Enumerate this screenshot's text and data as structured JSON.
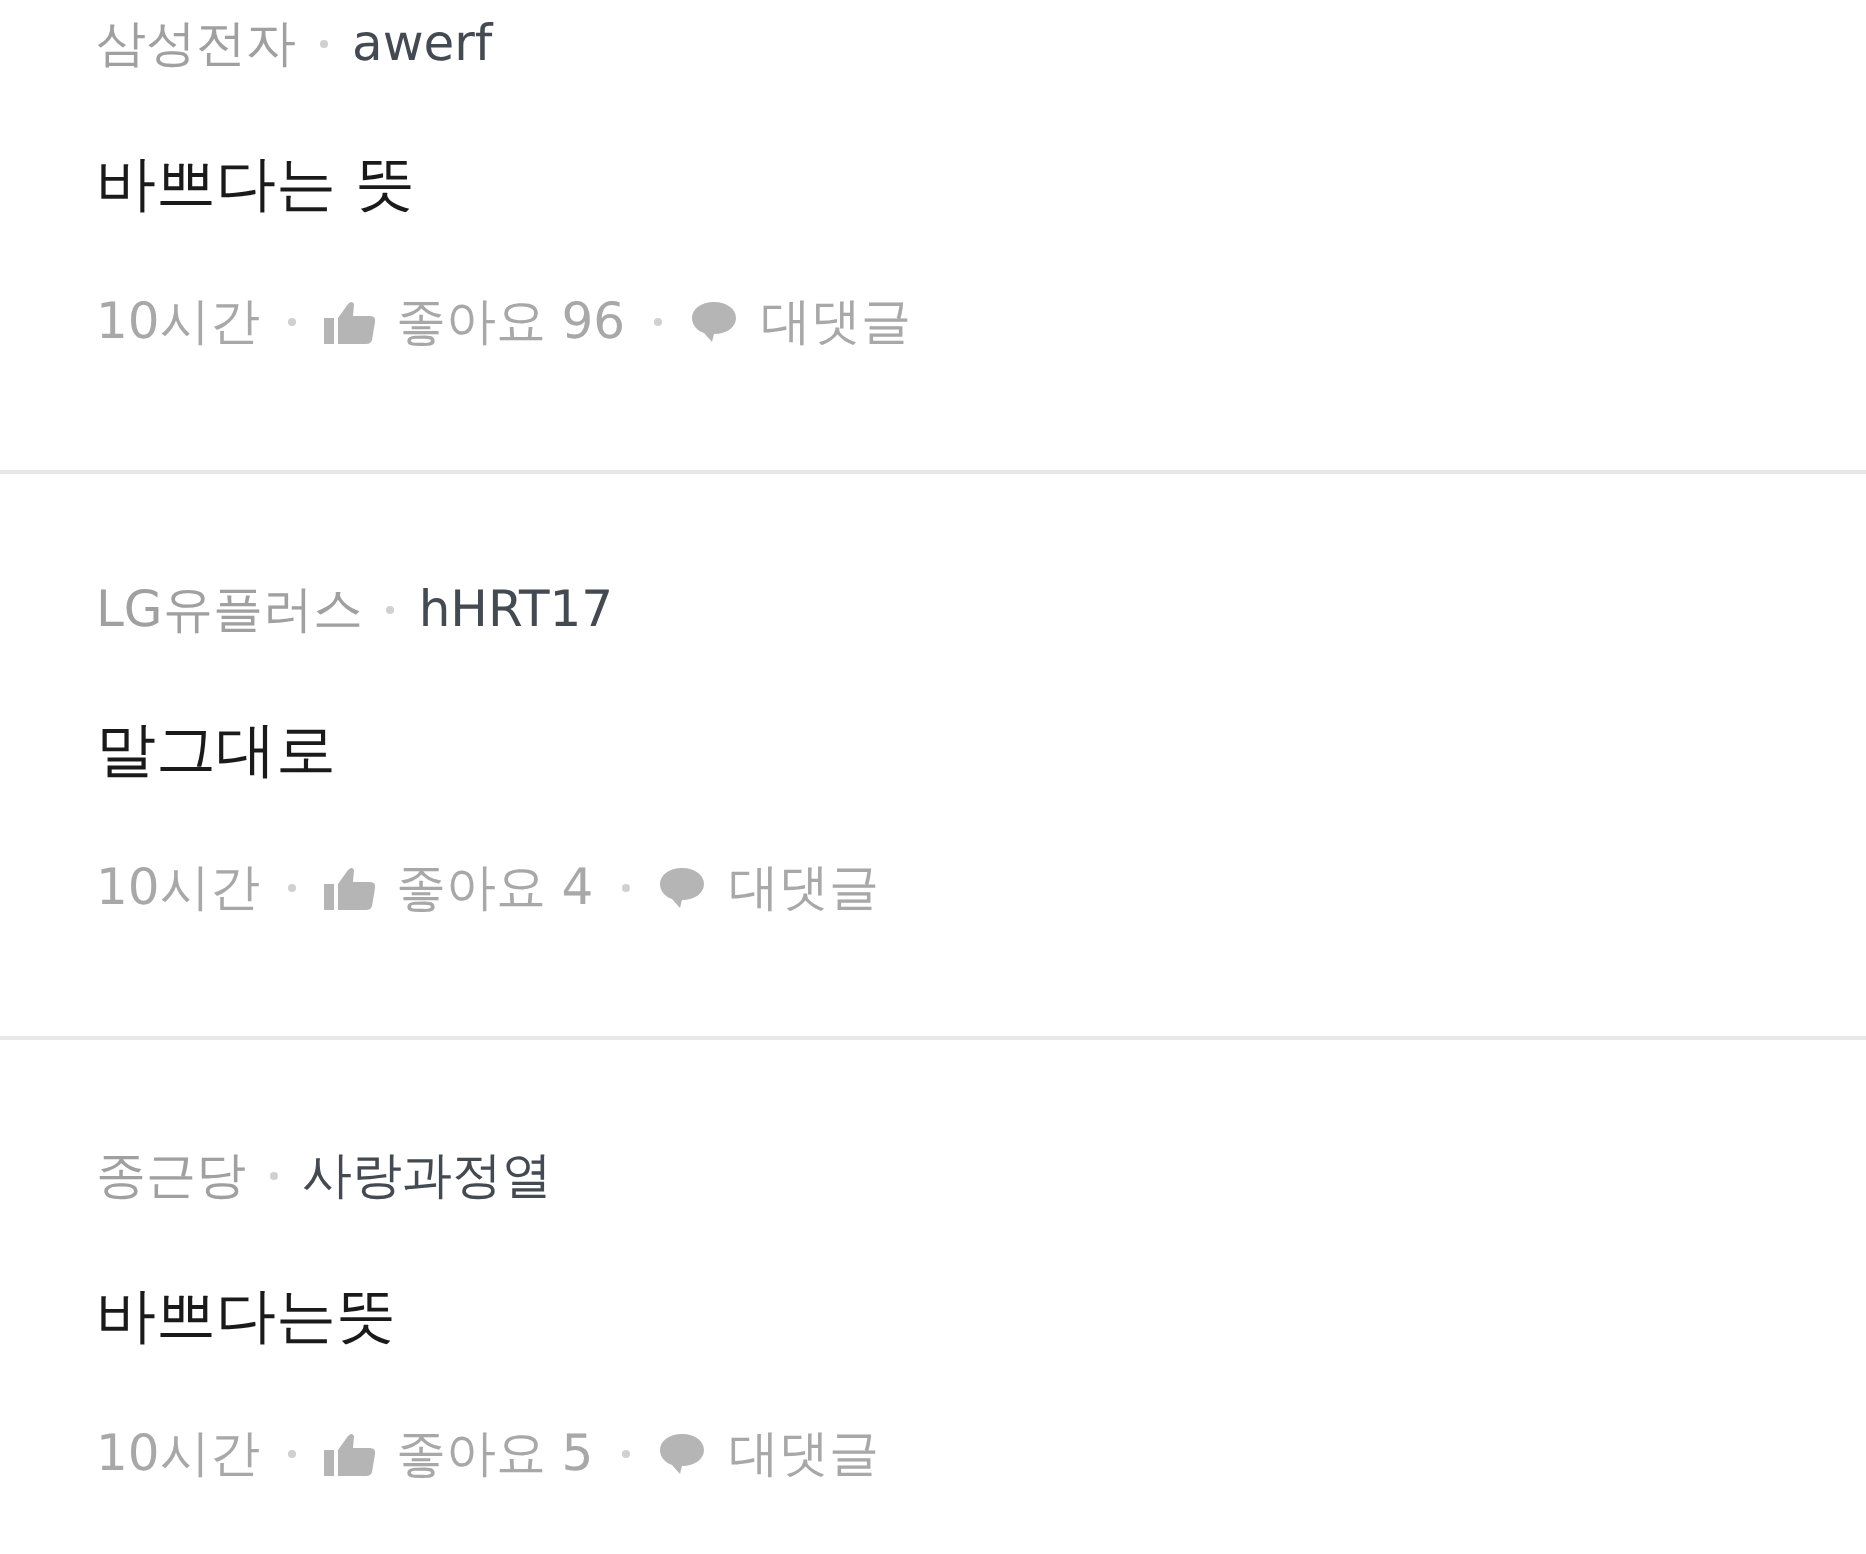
{
  "comments": [
    {
      "company": "삼성전자",
      "author": "awerf",
      "body": "바쁘다는 뜻",
      "time": "10시간",
      "likes": "좋아요 96",
      "reply": "대댓글"
    },
    {
      "company": "LG유플러스",
      "author": "hHRT17",
      "body": "말그대로",
      "time": "10시간",
      "likes": "좋아요 4",
      "reply": "대댓글"
    },
    {
      "company": "종근당",
      "author": "사랑과정열",
      "body": "바쁘다는뜻",
      "time": "10시간",
      "likes": "좋아요 5",
      "reply": "대댓글"
    }
  ]
}
